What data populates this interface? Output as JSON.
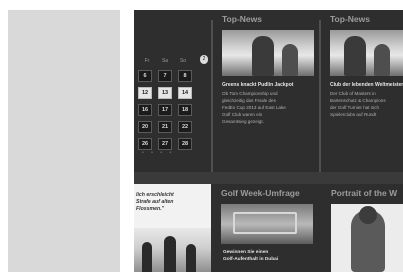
{
  "calendar": {
    "day_headers": [
      "Fr",
      "Sa",
      "So"
    ],
    "nav_label": "2",
    "dates": [
      "6",
      "7",
      "8",
      "12",
      "13",
      "14",
      "16",
      "17",
      "18",
      "20",
      "21",
      "22",
      "26",
      "27",
      "28"
    ],
    "highlighted": [
      "12",
      "13",
      "14"
    ],
    "pager": "• • • •"
  },
  "news": [
    {
      "title": "Top-News",
      "headline": "Greens knackt Pudlin Jackpot",
      "body": "Ob Tom Championship und\ngleichzeitig das Finale des\nFedEx Cup 2013 auf East Lake\nGolf Club waren ein\nGesamtsieg gezeigt."
    },
    {
      "title": "Top-News",
      "headline": "Club der lebenden Weltmeister",
      "body": "Der Club of Masters in\nBartenschutz & Champions\nder Golf Turnier hat sich\nSpielerclubs auf Rundt"
    }
  ],
  "partial_article": {
    "text": "lich erschleicht\nStrafe auf alten\nFlossmen.\""
  },
  "poll": {
    "title": "Golf Week-Umfrage",
    "text": "Gewinnen Sie einen\nGolf-Aufenthalt in Dubai"
  },
  "portrait": {
    "title": "Portrait of the W"
  }
}
